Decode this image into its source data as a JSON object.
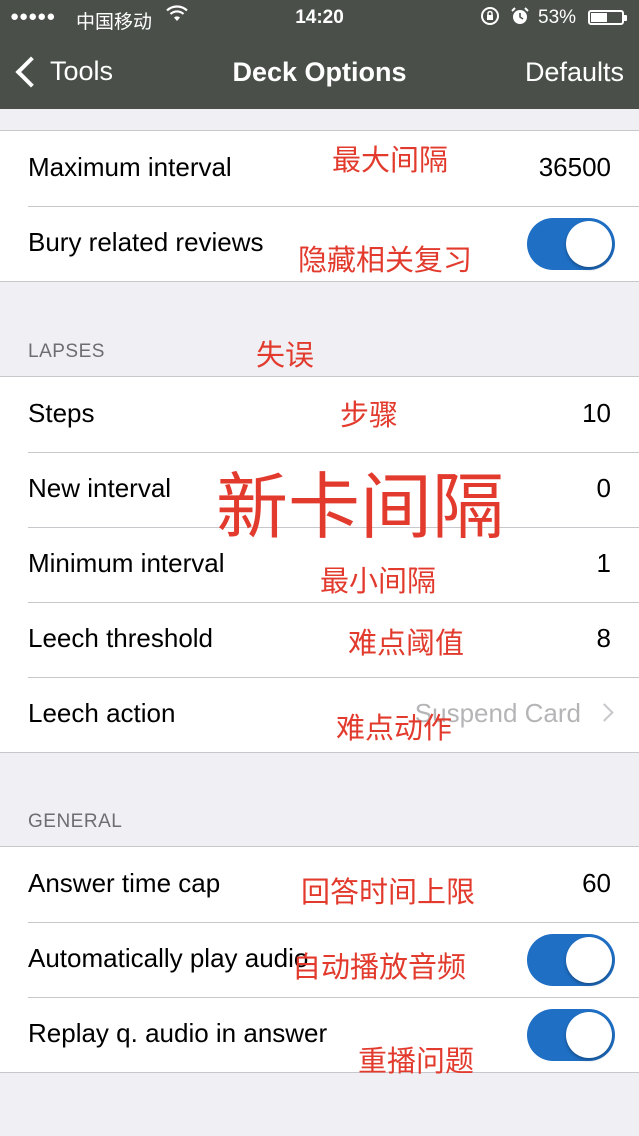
{
  "status_bar": {
    "signal": "●●●●●",
    "carrier": "中国移动",
    "time": "14:20",
    "battery_percent": "53%",
    "battery_level": 0.53
  },
  "nav": {
    "back_label": "Tools",
    "title": "Deck Options",
    "right_label": "Defaults"
  },
  "top_group": [
    {
      "label": "Maximum interval",
      "value": "36500"
    },
    {
      "label": "Bury related reviews",
      "toggle": true
    }
  ],
  "lapses": {
    "header": "LAPSES",
    "rows": [
      {
        "label": "Steps",
        "value": "10"
      },
      {
        "label": "New interval",
        "value": "0"
      },
      {
        "label": "Minimum interval",
        "value": "1"
      },
      {
        "label": "Leech threshold",
        "value": "8"
      },
      {
        "label": "Leech action",
        "value": "Suspend Card"
      }
    ]
  },
  "general": {
    "header": "GENERAL",
    "rows": [
      {
        "label": "Answer time cap",
        "value": "60"
      },
      {
        "label": "Automatically play audio",
        "toggle": true
      },
      {
        "label": "Replay q. audio in answer",
        "toggle": true
      }
    ]
  },
  "annotations": {
    "max_interval": "最大间隔",
    "bury": "隐藏相关复习",
    "lapses": "失误",
    "steps": "步骤",
    "new_interval": "新卡间隔",
    "min_interval": "最小间隔",
    "leech_threshold": "难点阈值",
    "leech_action": "难点动作",
    "answer_time_cap": "回答时间上限",
    "autoplay": "自动播放音频",
    "replay": "重播问题"
  },
  "colors": {
    "nav_bg": "#4a5049",
    "toggle_on": "#1f6fc5",
    "annotation": "#e23b2e"
  }
}
